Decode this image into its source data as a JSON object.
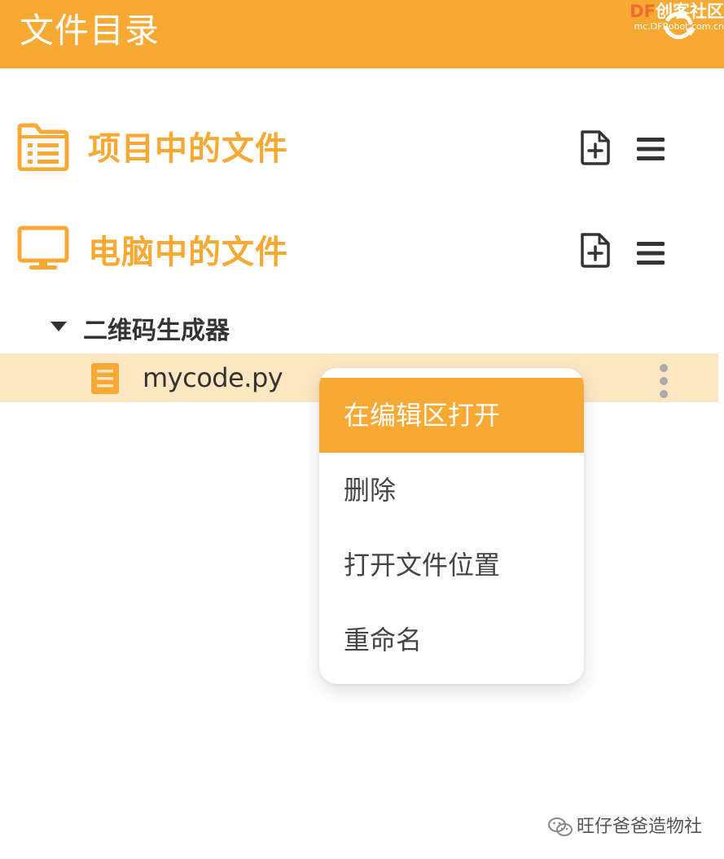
{
  "header": {
    "title": "文件目录",
    "refresh_icon": "refresh-icon",
    "background_color": "#F7A934"
  },
  "watermark_top": {
    "brand_df": "DF",
    "brand_cn": "创客社区",
    "url": "mc.DFRobot.com.cn"
  },
  "sections": [
    {
      "label": "项目中的文件",
      "icon": "folder-list-icon",
      "new_file_icon": "new-file-icon",
      "menu_icon": "menu-icon"
    },
    {
      "label": "电脑中的文件",
      "icon": "monitor-icon",
      "new_file_icon": "new-file-icon",
      "menu_icon": "menu-icon"
    }
  ],
  "tree": {
    "folder": {
      "label": "二维码生成器",
      "expanded": true,
      "caret_icon": "caret-down-icon"
    },
    "file": {
      "label": "mycode.py",
      "icon": "file-lines-icon",
      "more_icon": "more-vertical-icon",
      "selected": true,
      "highlight_color": "#FDE7C3"
    }
  },
  "context_menu": {
    "items": [
      {
        "label": "在编辑区打开",
        "active": true
      },
      {
        "label": "删除",
        "active": false
      },
      {
        "label": "打开文件位置",
        "active": false
      },
      {
        "label": "重命名",
        "active": false
      }
    ]
  },
  "watermark_bottom": {
    "icon": "wechat-icon",
    "text": "旺仔爸爸造物社"
  },
  "colors": {
    "accent": "#F7A934",
    "text_dark": "#333333",
    "selection": "#FDE7C3"
  }
}
